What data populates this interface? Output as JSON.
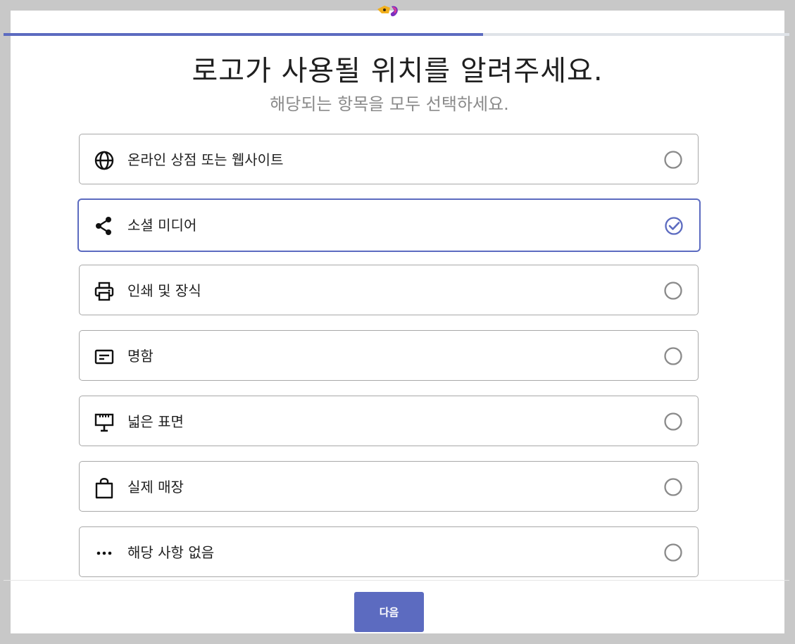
{
  "header": {
    "progress_percent": 61
  },
  "title": "로고가 사용될 위치를 알려주세요.",
  "subtitle": "해당되는 항목을 모두 선택하세요.",
  "accent_color": "#5c6bc0",
  "options": [
    {
      "label": "온라인 상점 또는 웹사이트",
      "icon": "globe-icon",
      "selected": false
    },
    {
      "label": "소셜 미디어",
      "icon": "share-icon",
      "selected": true
    },
    {
      "label": "인쇄 및 장식",
      "icon": "printer-icon",
      "selected": false
    },
    {
      "label": "명함",
      "icon": "business-card-icon",
      "selected": false
    },
    {
      "label": "넓은 표면",
      "icon": "billboard-icon",
      "selected": false
    },
    {
      "label": "실제 매장",
      "icon": "shopping-bag-icon",
      "selected": false
    },
    {
      "label": "해당 사항 없음",
      "icon": "more-dots-icon",
      "selected": false
    }
  ],
  "footer": {
    "next_label": "다음"
  }
}
